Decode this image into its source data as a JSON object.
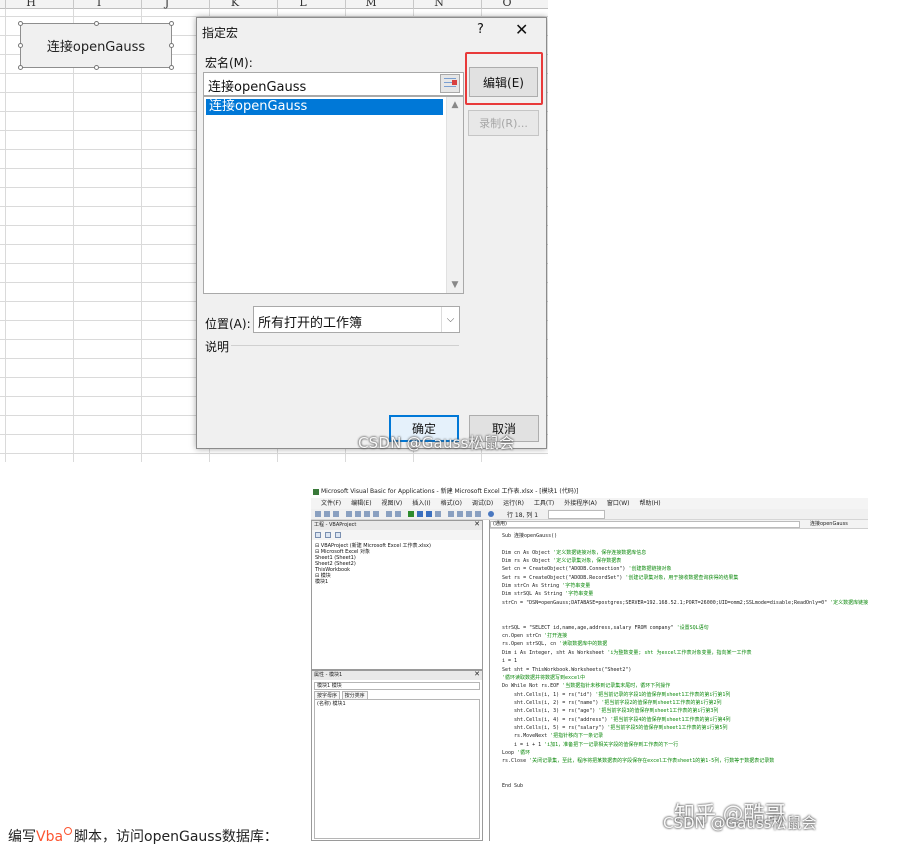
{
  "excel": {
    "columns": [
      "H",
      "I",
      "J",
      "K",
      "L",
      "M",
      "N",
      "O"
    ],
    "sheet_button": "连接openGauss"
  },
  "macro_dialog": {
    "title": "指定宏",
    "help_glyph": "?",
    "close_glyph": "✕",
    "macro_name_label": "宏名(M):",
    "macro_name_value": "连接openGauss",
    "macro_list": [
      "连接openGauss"
    ],
    "edit_button": "编辑(E)",
    "record_button": "录制(R)...",
    "location_label": "位置(A):",
    "location_value": "所有打开的工作簿",
    "description_label": "说明",
    "ok_button": "确定",
    "cancel_button": "取消",
    "highlight_color": "#e83a3a"
  },
  "watermarks": {
    "csdn_top": "CSDN @Gauss松鼠会",
    "csdn_bottom": "CSDN @Gauss松鼠会",
    "zhihu": "知乎 @酷哥"
  },
  "vba_editor": {
    "title": "Microsoft Visual Basic for Applications - 新建 Microsoft Excel 工作表.xlsx - [模块1 (代码)]",
    "menu": [
      "文件(F)",
      "编辑(E)",
      "视图(V)",
      "插入(I)",
      "格式(O)",
      "调试(D)",
      "运行(R)",
      "工具(T)",
      "外接程序(A)",
      "窗口(W)",
      "帮助(H)"
    ],
    "cursor_position": "行 18, 列 1",
    "project_pane_title": "工程 - VBAProject",
    "project_tree": [
      "⊟ VBAProject (新建 Microsoft Excel 工作表.xlsx)",
      "  ⊟ Microsoft Excel 对象",
      "      Sheet1 (Sheet1)",
      "      Sheet2 (Sheet2)",
      "      ThisWorkbook",
      "  ⊟ 模块",
      "      模块1"
    ],
    "props_pane_title": "属性 - 模块1",
    "props_combo": "模块1 模块",
    "props_tabs": [
      "按字母序",
      "按分类序"
    ],
    "props_row": "(名称) 模块1",
    "code_object": "(通用)",
    "code_proc": "连接openGauss",
    "code_lines": [
      {
        "t": "Sub 连接openGauss()",
        "c": ""
      },
      {
        "t": "",
        "c": ""
      },
      {
        "t": "Dim cn As Object ",
        "c": "'定义数据链接对象，保存连接数据库信息"
      },
      {
        "t": "Dim rs As Object ",
        "c": "'定义记录集对象，保存数据表"
      },
      {
        "t": "Set cn = CreateObject(\"ADODB.Connection\") ",
        "c": "'创建数据链接对象"
      },
      {
        "t": "Set rs = CreateObject(\"ADODB.RecordSet\") ",
        "c": "'创建记录集对象，用于接收数据查询获得的结果集"
      },
      {
        "t": "Dim strCn As String ",
        "c": "'字符串变量"
      },
      {
        "t": "Dim strSQL As String ",
        "c": "'字符串变量"
      },
      {
        "t": "strCn = \"DSN=openGauss;DATABASE=postgres;SERVER=192.168.52.1;PORT=26000;UID=omm2;SSLmode=disable;ReadOnly=0\" ",
        "c": "'定义数据库链接字符串"
      },
      {
        "t": "",
        "c": ""
      },
      {
        "t": "",
        "c": ""
      },
      {
        "t": "strSQL = \"SELECT id,name,age,address,salary FROM company\" ",
        "c": "'设置SQL语句"
      },
      {
        "t": "cn.Open strCn ",
        "c": "'打开连接"
      },
      {
        "t": "rs.Open strSQL, cn ",
        "c": "'读取数据库中的数据"
      },
      {
        "t": "Dim i As Integer, sht As Worksheet ",
        "c": "'i为整数变量; sht 为excel工作表对象变量，指向某一工作表"
      },
      {
        "t": "i = 1",
        "c": ""
      },
      {
        "t": "Set sht = ThisWorkbook.Worksheets(\"Sheet2\")",
        "c": ""
      },
      {
        "t": "",
        "c": "'循环读取数据并将数据写到excel中"
      },
      {
        "t": "Do While Not rs.EOF ",
        "c": "'当数据指针未移到记录集末尾时，循环下列操作"
      },
      {
        "t": "    sht.Cells(i, 1) = rs(\"id\") ",
        "c": "'把当前记录的字段1的值保存到sheet1工作表的第i行第1列"
      },
      {
        "t": "    sht.Cells(i, 2) = rs(\"name\") ",
        "c": "'把当前字段2的值保存到sheet1工作表的第i行第2列"
      },
      {
        "t": "    sht.Cells(i, 3) = rs(\"age\") ",
        "c": "'把当前字段3的值保存到sheet1工作表的第i行第3列"
      },
      {
        "t": "    sht.Cells(i, 4) = rs(\"address\") ",
        "c": "'把当前字段4的值保存到sheet1工作表的第i行第4列"
      },
      {
        "t": "    sht.Cells(i, 5) = rs(\"salary\") ",
        "c": "'把当前字段5的值保存到sheet1工作表的第i行第5列"
      },
      {
        "t": "    rs.MoveNext ",
        "c": "'把指针移向下一条记录"
      },
      {
        "t": "    i = i + 1 ",
        "c": "'i加1，准备把下一记录相关字段的值保存到工作表的下一行"
      },
      {
        "t": "Loop ",
        "c": "'循环"
      },
      {
        "t": "rs.Close ",
        "c": "'关闭记录集，至此，程序将把某数据表的字段保存在excel工作表sheet1的第1-5列，行数等于数据表记录数"
      },
      {
        "t": "",
        "c": ""
      },
      {
        "t": "",
        "c": ""
      },
      {
        "t": "End Sub",
        "c": ""
      }
    ]
  },
  "caption": {
    "prefix": "编写",
    "keyword": "Vba",
    "suffix": "脚本，访问openGauss数据库："
  }
}
